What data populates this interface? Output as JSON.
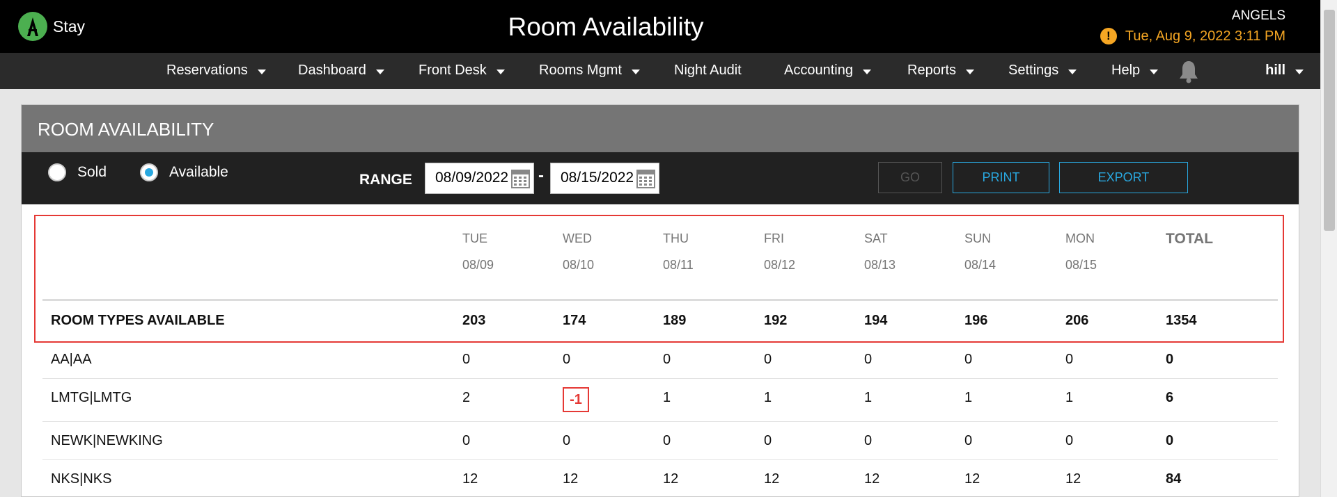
{
  "header": {
    "brand": "Stay",
    "title": "Room Availability",
    "property": "ANGELS",
    "datetime": "Tue, Aug 9, 2022 3:11 PM"
  },
  "nav": {
    "items": [
      {
        "label": "Reservations"
      },
      {
        "label": "Dashboard"
      },
      {
        "label": "Front Desk"
      },
      {
        "label": "Rooms Mgmt"
      },
      {
        "label": "Night Audit"
      },
      {
        "label": "Accounting"
      },
      {
        "label": "Reports"
      },
      {
        "label": "Settings"
      },
      {
        "label": "Help"
      }
    ],
    "user": "hill"
  },
  "panel": {
    "title": "ROOM AVAILABILITY",
    "radio_sold": "Sold",
    "radio_available": "Available",
    "selected": "Available",
    "range_label": "RANGE",
    "date_from": "08/09/2022",
    "date_to": "08/15/2022",
    "date_separator": "-",
    "btn_go": "GO",
    "btn_print": "PRINT",
    "btn_export": "EXPORT"
  },
  "table": {
    "columns": [
      {
        "day": "TUE",
        "date": "08/09"
      },
      {
        "day": "WED",
        "date": "08/10"
      },
      {
        "day": "THU",
        "date": "08/11"
      },
      {
        "day": "FRI",
        "date": "08/12"
      },
      {
        "day": "SAT",
        "date": "08/13"
      },
      {
        "day": "SUN",
        "date": "08/14"
      },
      {
        "day": "MON",
        "date": "08/15"
      }
    ],
    "total_header": "TOTAL",
    "summary": {
      "label": "ROOM TYPES AVAILABLE",
      "values": [
        "203",
        "174",
        "189",
        "192",
        "194",
        "196",
        "206"
      ],
      "total": "1354"
    },
    "rows": [
      {
        "label": "AA|AA",
        "values": [
          "0",
          "0",
          "0",
          "0",
          "0",
          "0",
          "0"
        ],
        "total": "0"
      },
      {
        "label": "LMTG|LMTG",
        "values": [
          "2",
          "-1",
          "1",
          "1",
          "1",
          "1",
          "1"
        ],
        "total": "6"
      },
      {
        "label": "NEWK|NEWKING",
        "values": [
          "0",
          "0",
          "0",
          "0",
          "0",
          "0",
          "0"
        ],
        "total": "0"
      },
      {
        "label": "NKS|NKS",
        "values": [
          "12",
          "12",
          "12",
          "12",
          "12",
          "12",
          "12"
        ],
        "total": "84"
      }
    ]
  },
  "colors": {
    "accent": "#29a8e0",
    "warning": "#f5a623",
    "negative": "#e53935",
    "logo": "#4caf50"
  }
}
